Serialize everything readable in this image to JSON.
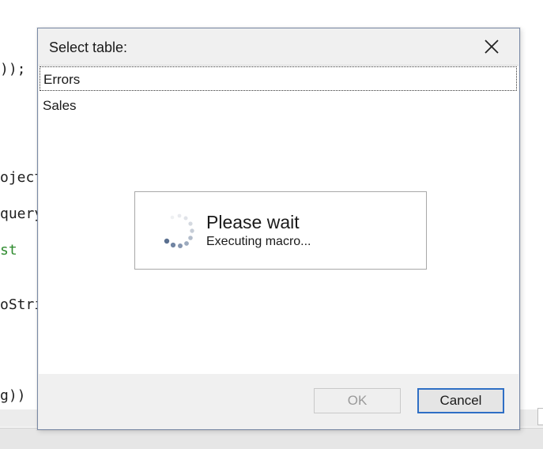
{
  "editor": {
    "lines": [
      {
        "text": "));",
        "color": "#1e1e1e"
      },
      {
        "text": "oject",
        "color": "#1e1e1e"
      },
      {
        "text": "query",
        "color": "#1e1e1e"
      },
      {
        "text": "st",
        "color": "#2e8b2e"
      },
      {
        "text": "oStri",
        "color": "#1e1e1e"
      },
      {
        "text": "g))",
        "color": "#1e1e1e"
      }
    ]
  },
  "dialog": {
    "title": "Select table:",
    "close_icon": "close-icon",
    "list": {
      "items": [
        {
          "label": "Errors",
          "selected": true
        },
        {
          "label": "Sales",
          "selected": false
        }
      ]
    },
    "wait": {
      "title": "Please wait",
      "subtitle": "Executing macro...",
      "spinner_icon": "loading-spinner-icon"
    },
    "buttons": {
      "ok_label": "OK",
      "cancel_label": "Cancel",
      "ok_enabled": false
    }
  },
  "colors": {
    "accent": "#2f6fc5",
    "dialog_border": "#7a8aa6",
    "dialog_bg": "#f0f0f0"
  }
}
